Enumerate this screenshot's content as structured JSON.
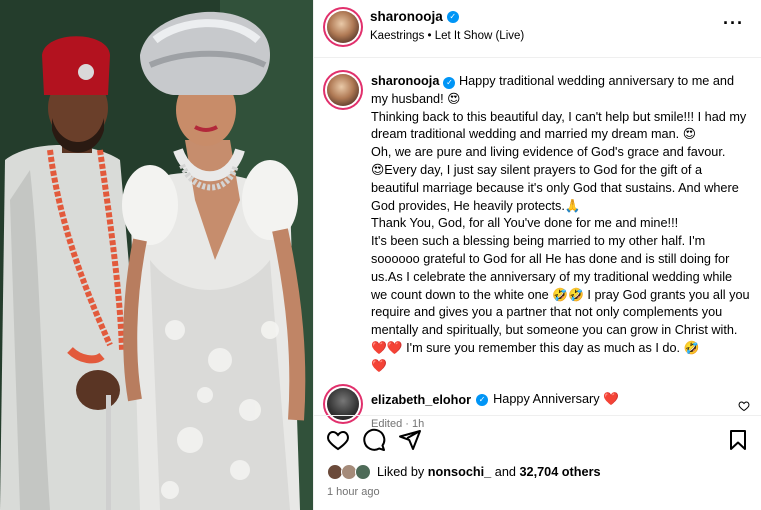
{
  "post": {
    "username": "sharonooja",
    "audio": "Kaestrings • Let It Show (Live)",
    "more_icon": "more-options-icon"
  },
  "caption": {
    "username": "sharonooja",
    "text": " Happy traditional wedding anniversary to me and my husband! 😍\nThinking back to this beautiful day, I can't help but smile!!! I had my dream traditional wedding and married my dream man. 😍\nOh, we are pure and living evidence of God's grace and favour.\n😍Every day, I just say silent prayers to God for the gift of a beautiful marriage because it's only God that sustains. And where God provides, He heavily protects.🙏\nThank You, God, for all You've done for me and mine!!!\nIt's been such a blessing being married to my other half. I'm soooooo grateful to God for all He has done and is still doing for us.As I celebrate the anniversary of my traditional wedding while we count down to the white one 🤣🤣 I pray God grants you all you require and gives you a partner that not only complements you mentally and spiritually, but someone you can grow in Christ with. ❤️❤️ I'm sure you remember this day as much as I do. 🤣\n❤️",
    "meta": "Edited · 1h"
  },
  "comment": {
    "username": "elizabeth_elohor",
    "text": "Happy Anniversary ❤️"
  },
  "likes": {
    "prefix": "Liked by ",
    "user": "nonsochi_",
    "middle": " and ",
    "count": "32,704 others"
  },
  "time": "1 hour ago",
  "colors": {
    "verified": "#0095f6",
    "story_ring": "#e1306c",
    "muted": "#737373"
  }
}
